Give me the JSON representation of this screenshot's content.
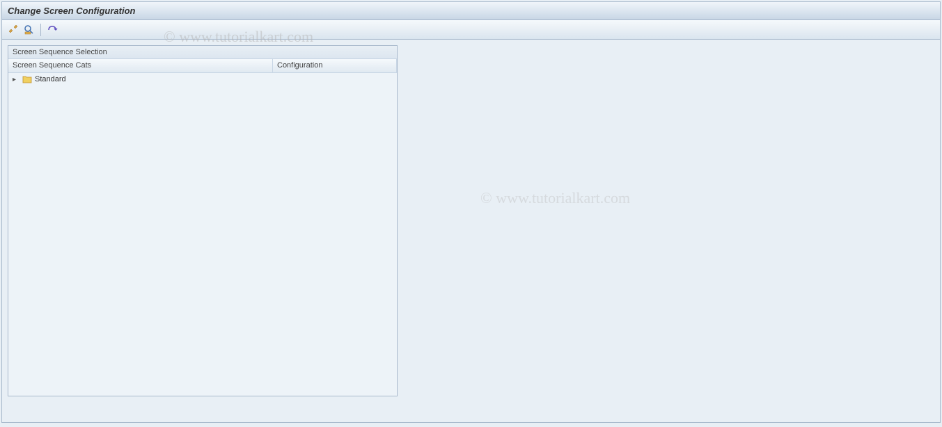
{
  "title": "Change Screen Configuration",
  "panel": {
    "header": "Screen Sequence Selection",
    "columns": {
      "cats": "Screen Sequence Cats",
      "config": "Configuration"
    },
    "tree": {
      "item1": "Standard"
    }
  },
  "watermark": "© www.tutorialkart.com"
}
